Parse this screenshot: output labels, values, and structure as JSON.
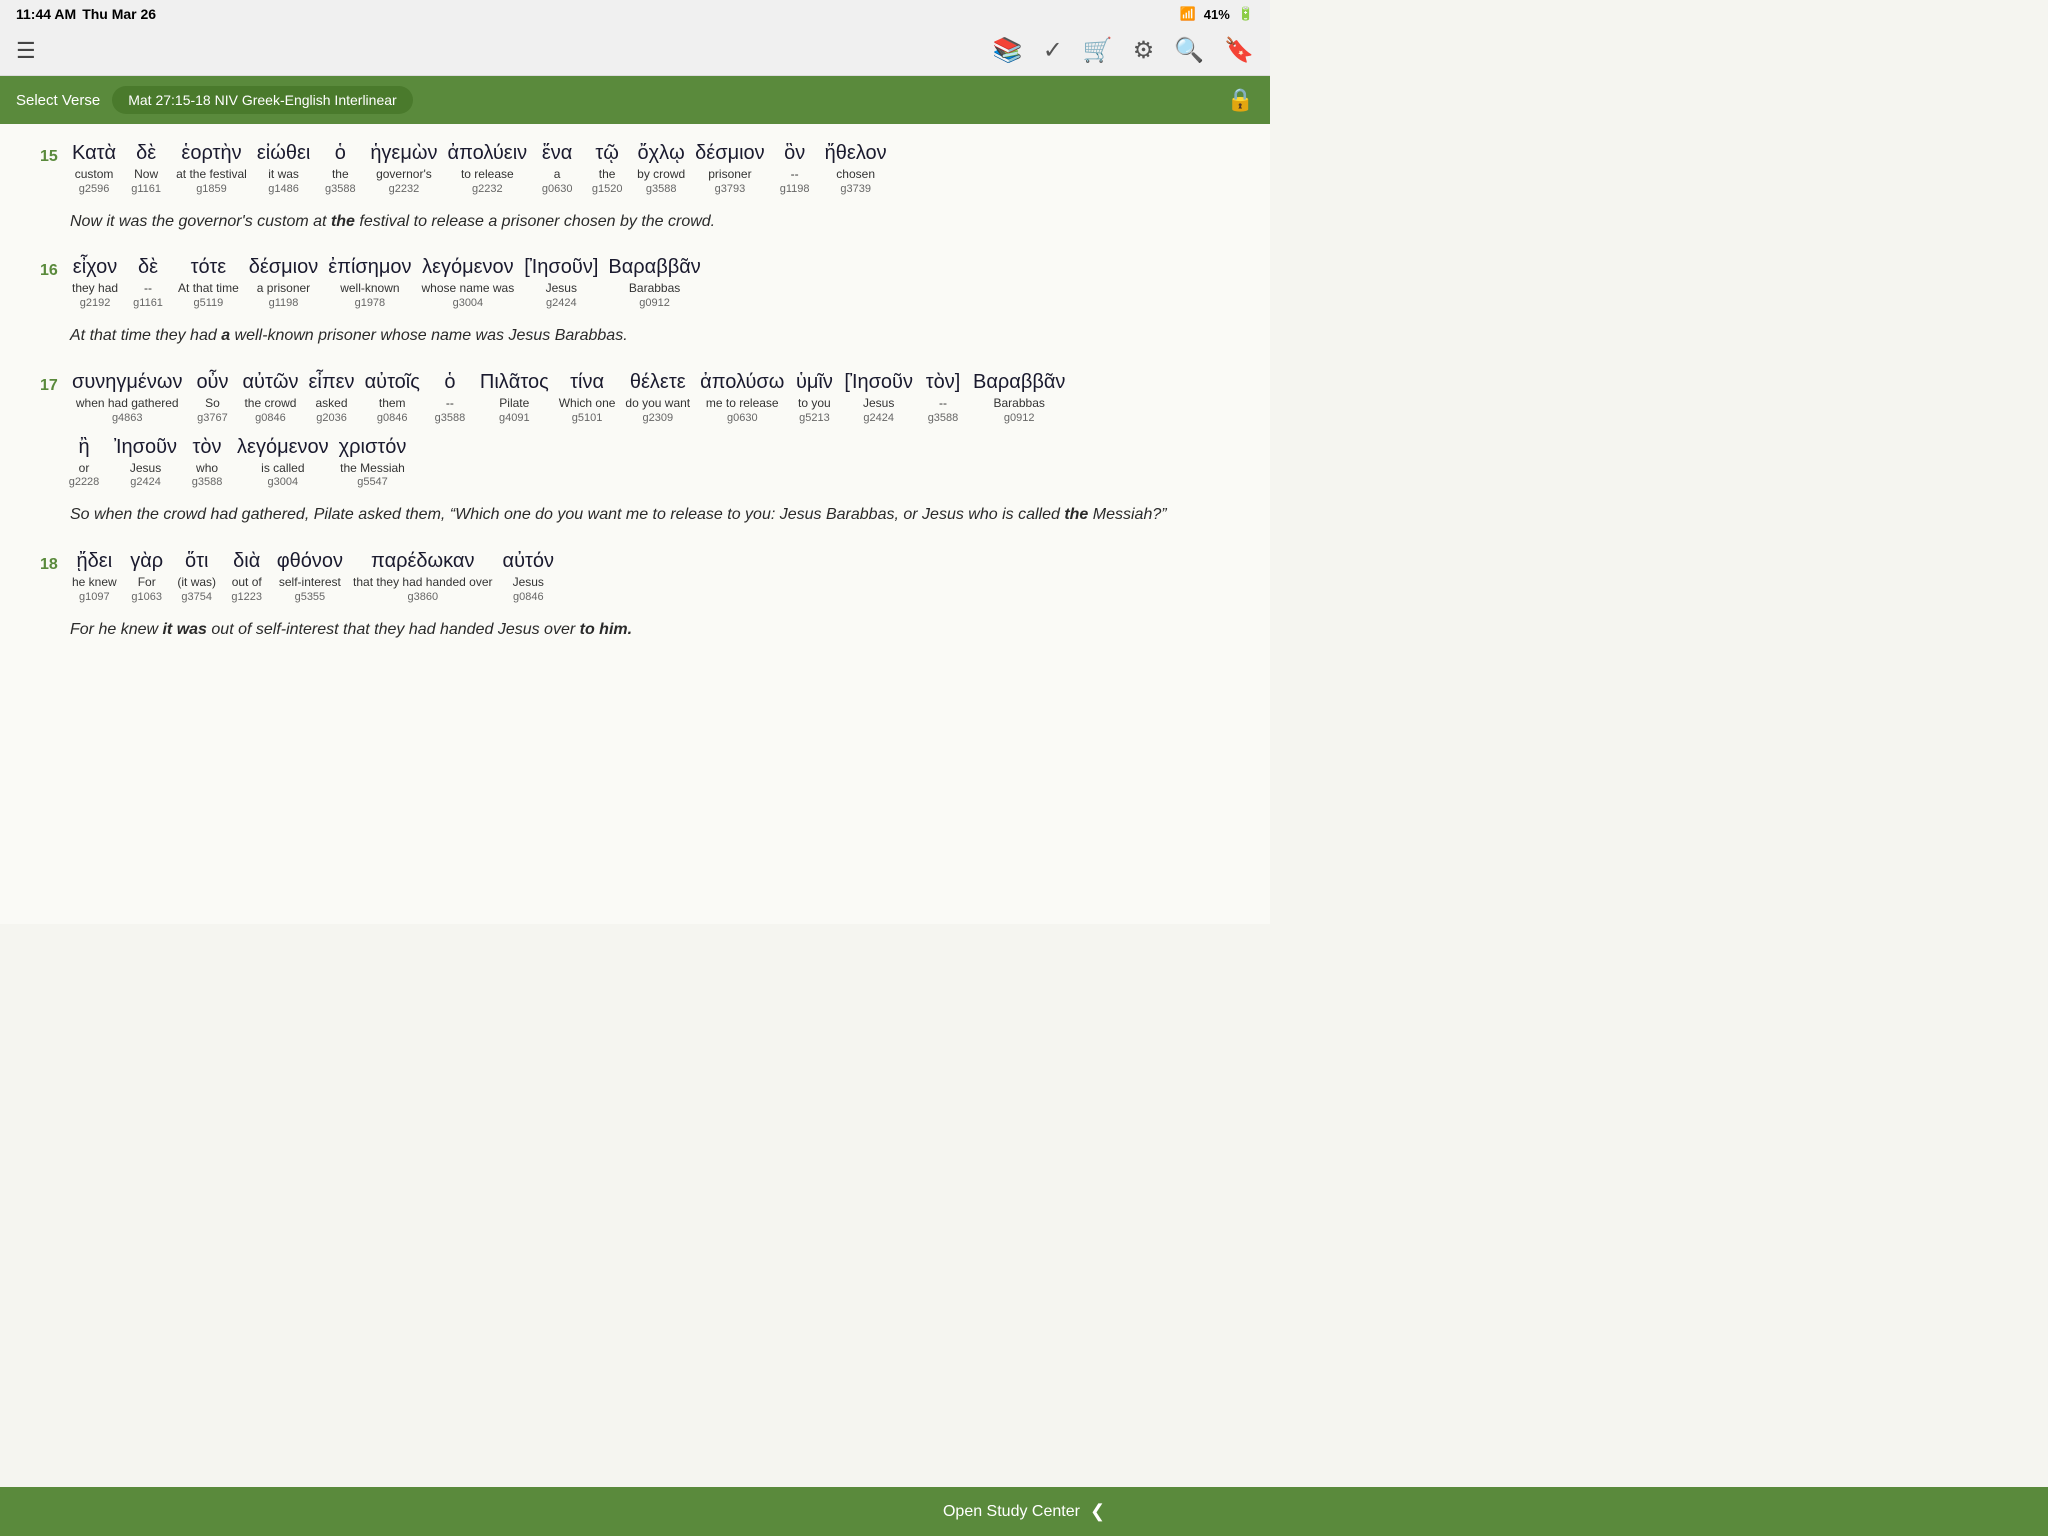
{
  "statusBar": {
    "time": "11:44 AM",
    "day": "Thu Mar 26",
    "wifi": "WiFi",
    "battery": "41%"
  },
  "toolbar": {
    "icons": [
      "library",
      "bookmark-check",
      "cart",
      "settings",
      "search",
      "bookmark"
    ]
  },
  "header": {
    "selectVerseLabel": "Select Verse",
    "versionBadge": "Mat 27:15-18 NIV Greek-English Interlinear"
  },
  "verses": [
    {
      "num": "15",
      "words": [
        {
          "greek": "Κατὰ",
          "english": "custom",
          "strongs": "g2596"
        },
        {
          "greek": "δὲ",
          "english": "Now",
          "strongs": "g1161"
        },
        {
          "greek": "ἑορτὴν",
          "english": "at the festival",
          "strongs": "g1859"
        },
        {
          "greek": "εἰώθει",
          "english": "it was",
          "strongs": "g1486"
        },
        {
          "greek": "ὁ",
          "english": "the",
          "strongs": "g3588"
        },
        {
          "greek": "ἡγεμὼν",
          "english": "governor's",
          "strongs": "g2232"
        },
        {
          "greek": "ἀπολύειν",
          "english": "to release",
          "strongs": "g2232"
        },
        {
          "greek": "ἕνα",
          "english": "a",
          "strongs": "g0630"
        },
        {
          "greek": "τῷ",
          "english": "the",
          "strongs": "g1520"
        },
        {
          "greek": "ὄχλῳ",
          "english": "by crowd",
          "strongs": "g3588"
        },
        {
          "greek": "δέσμιον",
          "english": "prisoner",
          "strongs": "g3793"
        },
        {
          "greek": "ὃν",
          "english": "--",
          "strongs": "g1198"
        },
        {
          "greek": "ἤθελον",
          "english": "chosen",
          "strongs": "g3739"
        }
      ],
      "translation": "Now it was the governor's custom at the festival to release a prisoner chosen by the crowd."
    },
    {
      "num": "16",
      "words": [
        {
          "greek": "εἶχον",
          "english": "they had",
          "strongs": "g2192"
        },
        {
          "greek": "δὲ",
          "english": "--",
          "strongs": "g1161"
        },
        {
          "greek": "τότε",
          "english": "At that time",
          "strongs": "g5119"
        },
        {
          "greek": "δέσμιον",
          "english": "a prisoner",
          "strongs": "g1198"
        },
        {
          "greek": "ἐπίσημον",
          "english": "well-known",
          "strongs": "g1978"
        },
        {
          "greek": "λεγόμενον",
          "english": "whose name was",
          "strongs": "g3004"
        },
        {
          "greek": "[Ἰησοῦν]",
          "english": "Jesus",
          "strongs": "g2424"
        },
        {
          "greek": "Βαραββᾶν",
          "english": "Barabbas",
          "strongs": "g0912"
        }
      ],
      "translation": "At that time they had a well-known prisoner whose name was Jesus Barabbas."
    },
    {
      "num": "17",
      "words": [
        {
          "greek": "συνηγμένων",
          "english": "when had gathered",
          "strongs": "g4863"
        },
        {
          "greek": "οὖν",
          "english": "So",
          "strongs": "g3767"
        },
        {
          "greek": "αὐτῶν",
          "english": "the crowd",
          "strongs": "g0846"
        },
        {
          "greek": "εἶπεν",
          "english": "asked",
          "strongs": "g2036"
        },
        {
          "greek": "αὐτοῖς",
          "english": "them",
          "strongs": "g0846"
        },
        {
          "greek": "ὁ",
          "english": "--",
          "strongs": "g3588"
        },
        {
          "greek": "Πιλᾶτος",
          "english": "Pilate",
          "strongs": "g4091"
        },
        {
          "greek": "τίνα",
          "english": "Which one",
          "strongs": "g5101"
        },
        {
          "greek": "θέλετε",
          "english": "do you want",
          "strongs": "g2309"
        },
        {
          "greek": "ἀπολύσω",
          "english": "me to release",
          "strongs": "g0630"
        },
        {
          "greek": "ὑμῖν",
          "english": "to you",
          "strongs": "g5213"
        },
        {
          "greek": "[Ἰησοῦν",
          "english": "Jesus",
          "strongs": "g2424"
        },
        {
          "greek": "τὸν]",
          "english": "--",
          "strongs": "g3588"
        },
        {
          "greek": "Βαραββᾶν",
          "english": "Barabbas",
          "strongs": "g0912"
        }
      ],
      "words2": [
        {
          "greek": "ἢ",
          "english": "or",
          "strongs": "g2228"
        },
        {
          "greek": "Ἰησοῦν",
          "english": "Jesus",
          "strongs": "g2424"
        },
        {
          "greek": "τὸν",
          "english": "who",
          "strongs": "g3588"
        },
        {
          "greek": "λεγόμενον",
          "english": "is called",
          "strongs": "g3004"
        },
        {
          "greek": "χριστόν",
          "english": "the Messiah",
          "strongs": "g5547"
        }
      ],
      "translation": "So when the crowd had gathered, Pilate asked them, \"Which one do you want me to release to you: Jesus Barabbas, or Jesus who is called the Messiah?\""
    },
    {
      "num": "18",
      "words": [
        {
          "greek": "ᾔδει",
          "english": "he knew",
          "strongs": "g1097"
        },
        {
          "greek": "γὰρ",
          "english": "For",
          "strongs": "g1063"
        },
        {
          "greek": "ὅτι",
          "english": "(it was)",
          "strongs": "g3754"
        },
        {
          "greek": "διὰ",
          "english": "out of",
          "strongs": "g1223"
        },
        {
          "greek": "φθόνον",
          "english": "self-interest",
          "strongs": "g5355"
        },
        {
          "greek": "παρέδωκαν",
          "english": "that they had handed over",
          "strongs": "g3860"
        },
        {
          "greek": "αὐτόν",
          "english": "Jesus",
          "strongs": "g0846"
        }
      ],
      "translation": "For he knew it was out of self-interest that they had handed Jesus over to him."
    }
  ],
  "bottomBar": {
    "label": "Open Study Center",
    "chevron": "❮"
  }
}
